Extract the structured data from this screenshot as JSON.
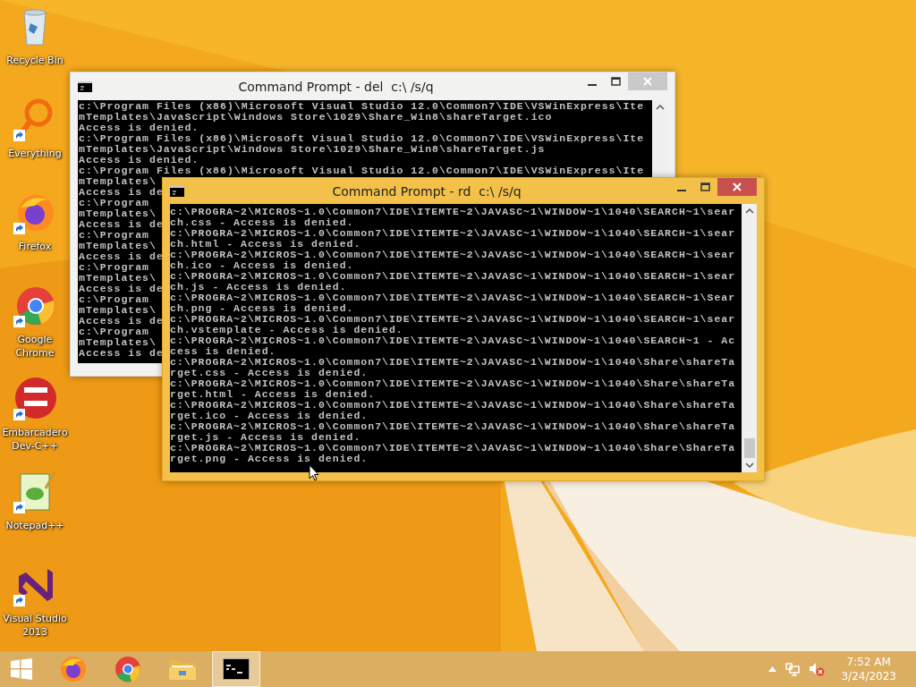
{
  "desktop_icons": [
    {
      "label": "Recycle Bin",
      "shortcut": false
    },
    {
      "label": "Everything",
      "shortcut": true
    },
    {
      "label": "Firefox",
      "shortcut": true
    },
    {
      "label": "Google Chrome",
      "shortcut": true
    },
    {
      "label": "Embarcadero Dev-C++",
      "shortcut": true
    },
    {
      "label": "Notepad++",
      "shortcut": true
    },
    {
      "label": "Visual Studio 2013",
      "shortcut": true
    }
  ],
  "windows": [
    {
      "title": "Command Prompt - del  c:\\ /s/q",
      "active": false,
      "lines": [
        "c:\\Program Files (x86)\\Microsoft Visual Studio 12.0\\Common7\\IDE\\VSWinExpress\\Ite",
        "mTemplates\\JavaScript\\Windows Store\\1029\\Share_Win8\\shareTarget.ico",
        "Access is denied.",
        "c:\\Program Files (x86)\\Microsoft Visual Studio 12.0\\Common7\\IDE\\VSWinExpress\\Ite",
        "mTemplates\\JavaScript\\Windows Store\\1029\\Share_Win8\\shareTarget.js",
        "Access is denied.",
        "c:\\Program Files (x86)\\Microsoft Visual Studio 12.0\\Common7\\IDE\\VSWinExpress\\Ite",
        "mTemplates\\",
        "Access is de",
        "c:\\Program",
        "mTemplates\\",
        "Access is de",
        "c:\\Program",
        "mTemplates\\",
        "Access is de",
        "c:\\Program",
        "mTemplates\\",
        "Access is de",
        "c:\\Program",
        "mTemplates\\",
        "Access is de",
        "c:\\Program",
        "mTemplates\\",
        "Access is de"
      ]
    },
    {
      "title": "Command Prompt - rd  c:\\ /s/q",
      "active": true,
      "lines": [
        "c:\\PROGRA~2\\MICROS~1.0\\Common7\\IDE\\ITEMTE~2\\JAVASC~1\\WINDOW~1\\1040\\SEARCH~1\\sear",
        "ch.css - Access is denied.",
        "c:\\PROGRA~2\\MICROS~1.0\\Common7\\IDE\\ITEMTE~2\\JAVASC~1\\WINDOW~1\\1040\\SEARCH~1\\sear",
        "ch.html - Access is denied.",
        "c:\\PROGRA~2\\MICROS~1.0\\Common7\\IDE\\ITEMTE~2\\JAVASC~1\\WINDOW~1\\1040\\SEARCH~1\\sear",
        "ch.ico - Access is denied.",
        "c:\\PROGRA~2\\MICROS~1.0\\Common7\\IDE\\ITEMTE~2\\JAVASC~1\\WINDOW~1\\1040\\SEARCH~1\\sear",
        "ch.js - Access is denied.",
        "c:\\PROGRA~2\\MICROS~1.0\\Common7\\IDE\\ITEMTE~2\\JAVASC~1\\WINDOW~1\\1040\\SEARCH~1\\Sear",
        "ch.png - Access is denied.",
        "c:\\PROGRA~2\\MICROS~1.0\\Common7\\IDE\\ITEMTE~2\\JAVASC~1\\WINDOW~1\\1040\\SEARCH~1\\sear",
        "ch.vstemplate - Access is denied.",
        "c:\\PROGRA~2\\MICROS~1.0\\Common7\\IDE\\ITEMTE~2\\JAVASC~1\\WINDOW~1\\1040\\SEARCH~1 - Ac",
        "cess is denied.",
        "c:\\PROGRA~2\\MICROS~1.0\\Common7\\IDE\\ITEMTE~2\\JAVASC~1\\WINDOW~1\\1040\\Share\\shareTa",
        "rget.css - Access is denied.",
        "c:\\PROGRA~2\\MICROS~1.0\\Common7\\IDE\\ITEMTE~2\\JAVASC~1\\WINDOW~1\\1040\\Share\\shareTa",
        "rget.html - Access is denied.",
        "c:\\PROGRA~2\\MICROS~1.0\\Common7\\IDE\\ITEMTE~2\\JAVASC~1\\WINDOW~1\\1040\\Share\\shareTa",
        "rget.ico - Access is denied.",
        "c:\\PROGRA~2\\MICROS~1.0\\Common7\\IDE\\ITEMTE~2\\JAVASC~1\\WINDOW~1\\1040\\Share\\shareTa",
        "rget.js - Access is denied.",
        "c:\\PROGRA~2\\MICROS~1.0\\Common7\\IDE\\ITEMTE~2\\JAVASC~1\\WINDOW~1\\1040\\Share\\ShareTa",
        "rget.png - Access is denied."
      ]
    }
  ],
  "taskbar": {
    "apps": [
      {
        "selected": false
      },
      {
        "selected": false
      },
      {
        "selected": false
      },
      {
        "selected": true
      }
    ],
    "clock": {
      "time": "7:52 AM",
      "date": "3/24/2023"
    }
  }
}
